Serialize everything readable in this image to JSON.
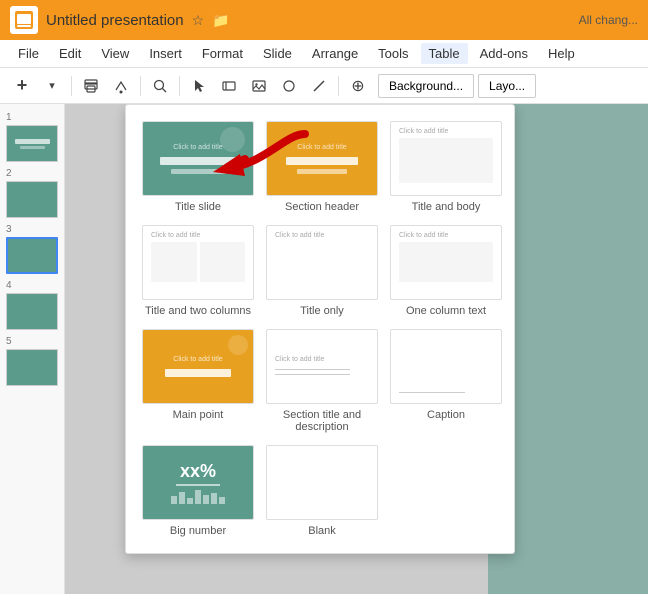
{
  "app": {
    "title": "Untitled presentation",
    "logo_char": "🖼",
    "all_changes_saved": "All chang..."
  },
  "menu": {
    "items": [
      "File",
      "Edit",
      "View",
      "Insert",
      "Format",
      "Slide",
      "Arrange",
      "Tools",
      "Table",
      "Add-ons",
      "Help"
    ]
  },
  "toolbar": {
    "background_label": "Background...",
    "layout_label": "Layo..."
  },
  "slides": [
    {
      "num": "1"
    },
    {
      "num": "2"
    },
    {
      "num": "3"
    },
    {
      "num": "4"
    },
    {
      "num": "5"
    }
  ],
  "layout_dropdown": {
    "items": [
      {
        "id": "title-slide",
        "label": "Title slide"
      },
      {
        "id": "section-header",
        "label": "Section header"
      },
      {
        "id": "title-and-body",
        "label": "Title and body"
      },
      {
        "id": "title-two-columns",
        "label": "Title and two columns"
      },
      {
        "id": "title-only",
        "label": "Title only"
      },
      {
        "id": "one-column-text",
        "label": "One column text"
      },
      {
        "id": "main-point",
        "label": "Main point"
      },
      {
        "id": "section-title-desc",
        "label": "Section title and\ndescription"
      },
      {
        "id": "caption",
        "label": "Caption"
      },
      {
        "id": "big-number",
        "label": "Big number"
      },
      {
        "id": "blank",
        "label": "Blank"
      }
    ]
  }
}
